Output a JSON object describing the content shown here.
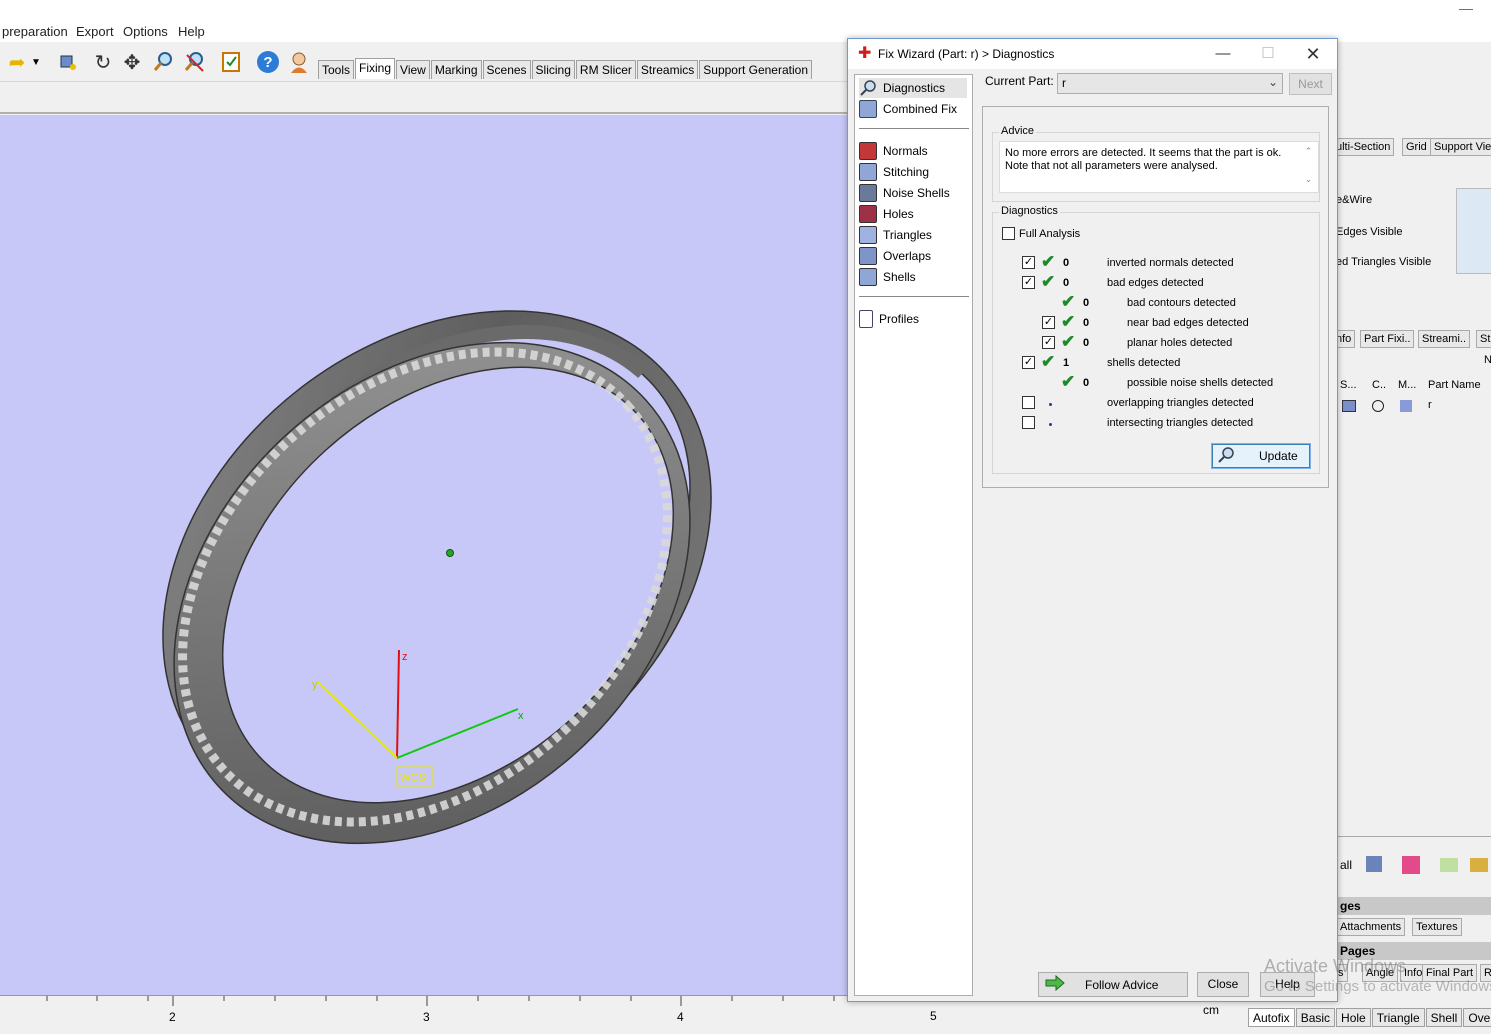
{
  "menu": {
    "items": [
      "preparation",
      "Export",
      "Options",
      "Help"
    ]
  },
  "toolbar": {
    "tabs": [
      "Tools",
      "Fixing",
      "View",
      "Marking",
      "Scenes",
      "Slicing",
      "RM Slicer",
      "Streamics",
      "Support Generation"
    ],
    "active_tab": "Fixing"
  },
  "viewport": {
    "background": "#c8c8f8",
    "axis_labels": {
      "z": "z",
      "y": "y",
      "x": "x",
      "wcs": "WCS"
    },
    "ruler": {
      "labels": [
        "2",
        "3",
        "4",
        "5"
      ],
      "unit": "cm"
    }
  },
  "dialog": {
    "title": "Fix Wizard (Part: r) > Diagnostics",
    "nav": {
      "group1": [
        "Diagnostics",
        "Combined Fix"
      ],
      "group2": [
        "Normals",
        "Stitching",
        "Noise Shells",
        "Holes",
        "Triangles",
        "Overlaps",
        "Shells"
      ],
      "group3": [
        "Profiles"
      ],
      "selected": "Diagnostics"
    },
    "current_part_label": "Current Part:",
    "current_part_value": "r",
    "next_label": "Next",
    "advice": {
      "title": "Advice",
      "line1": "No more errors are detected. It seems that the part is ok.",
      "line2": "Note that not all parameters were analysed."
    },
    "diagnostics": {
      "title": "Diagnostics",
      "full_analysis_label": "Full Analysis",
      "rows": [
        {
          "checkbox": true,
          "checked": true,
          "status": "ok",
          "count": "0",
          "label": "inverted normals detected"
        },
        {
          "checkbox": true,
          "checked": true,
          "status": "ok",
          "count": "0",
          "label": "bad edges detected"
        },
        {
          "checkbox": false,
          "checked": false,
          "status": "ok",
          "count": "0",
          "label": "bad contours detected"
        },
        {
          "checkbox": true,
          "checked": true,
          "status": "ok",
          "count": "0",
          "label": "near bad edges detected"
        },
        {
          "checkbox": true,
          "checked": true,
          "status": "ok",
          "count": "0",
          "label": "planar holes detected"
        },
        {
          "checkbox": true,
          "checked": true,
          "status": "ok",
          "count": "1",
          "label": "shells detected"
        },
        {
          "checkbox": false,
          "checked": false,
          "status": "ok",
          "count": "0",
          "label": "possible noise shells detected"
        },
        {
          "checkbox": true,
          "checked": false,
          "status": "pending",
          "count": "",
          "label": "overlapping triangles detected"
        },
        {
          "checkbox": true,
          "checked": false,
          "status": "pending",
          "count": "",
          "label": "intersecting triangles detected"
        }
      ],
      "update_label": "Update"
    },
    "buttons": {
      "follow_advice": "Follow Advice",
      "close": "Close",
      "help": "Help"
    }
  },
  "right_panel": {
    "tabs_top": [
      "ulti-Section",
      "Grid",
      "Support Vie"
    ],
    "options": [
      "e&Wire",
      "Edges Visible",
      "ed Triangles Visible"
    ],
    "tabs_mid": [
      "nfo",
      "Part Fixi..",
      "Streami..",
      "St"
    ],
    "columns": [
      "S...",
      "C..",
      "M...",
      "Part Name"
    ],
    "row_part": "r",
    "letter_n": "N",
    "all_label": "all",
    "section1": "ges",
    "tabs_attach": [
      "Attachments",
      "Textures"
    ],
    "section2": "Pages",
    "tabs_pages": [
      "s",
      "Angle",
      "Info",
      "Final Part",
      "R"
    ]
  },
  "bottom_tabs": [
    "Autofix",
    "Basic",
    "Hole",
    "Triangle",
    "Shell",
    "Overla"
  ],
  "watermark": {
    "line1": "Activate Windows",
    "line2": "Go to Settings to activate Windows."
  }
}
